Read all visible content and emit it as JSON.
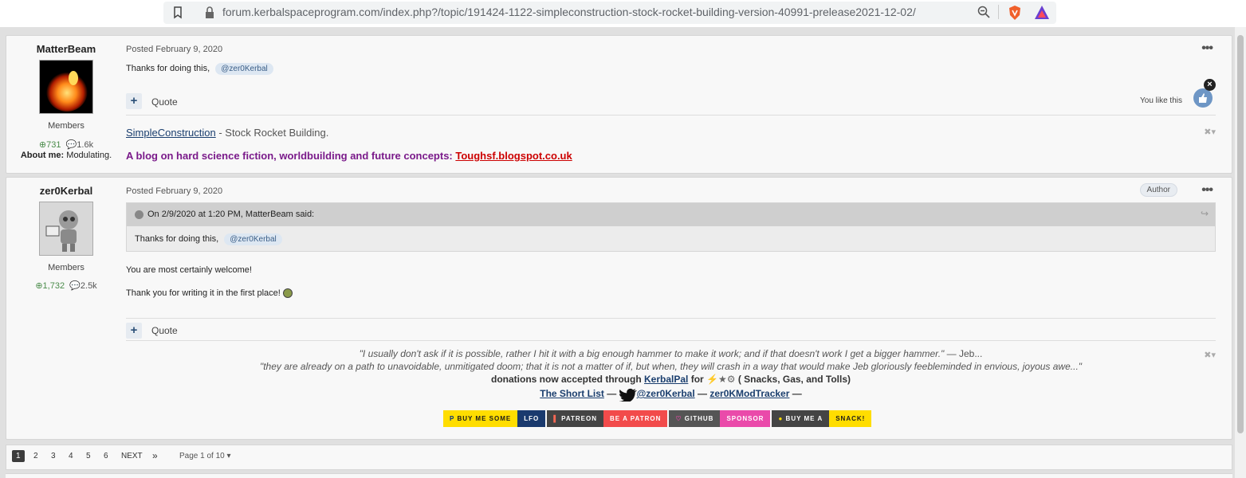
{
  "browser": {
    "url": "forum.kerbalspaceprogram.com/index.php?/topic/191424-1122-simpleconstruction-stock-rocket-building-version-40991-prelease2021-12-02/"
  },
  "posts": [
    {
      "username": "MatterBeam",
      "role": "Members",
      "reputation": "731",
      "post_count": "1.6k",
      "about_label": "About me:",
      "about_value": "Modulating.",
      "posted": "Posted February 9, 2020",
      "body": "Thanks for doing this,",
      "mention": "@zer0Kerbal",
      "quote_label": "Quote",
      "you_like": "You like this",
      "signature": {
        "link": "SimpleConstruction",
        "rest": " - Stock Rocket Building.",
        "blog_text": "A blog on hard science fiction, worldbuilding and future concepts: ",
        "blog_link": "Toughsf.blogspot.co.uk"
      }
    },
    {
      "username": "zer0Kerbal",
      "role": "Members",
      "reputation": "1,732",
      "post_count": "2.5k",
      "posted": "Posted February 9, 2020",
      "badge": "Author",
      "quote_header": "On 2/9/2020 at 1:20 PM, MatterBeam said:",
      "quote_body": "Thanks for doing this,",
      "quote_mention": "@zer0Kerbal",
      "line1": "You are most certainly welcome!",
      "line2": "Thank you for writing it in the first place!",
      "quote_label": "Quote",
      "signature": {
        "q1": "\"I usually don't ask if it is possible, rather I hit it with a big enough hammer to make it work; and if that doesn't work I get a bigger hammer.\"",
        "q1_attr": " — Jeb...",
        "q2": "\"they are already on a path to unavoidable, unmitigated doom; that it is not a matter of if, but when, they will crash in a way that would make Jeb gloriously feebleminded in envious, joyous awe...\"",
        "donation_pre": "donations now accepted through ",
        "donation_link": "KerbalPal",
        "donation_for": " for ",
        "donation_post": " ( Snacks, Gas, and Tolls)",
        "short_list": "The Short List",
        "dash": " — ",
        "twitter": "@zer0Kerbal",
        "tracker": "zer0KModTracker",
        "dash_end": " —",
        "badges": [
          {
            "left": "BUY ME SOME",
            "right": "LFO"
          },
          {
            "left": "PATREON",
            "right": "BE A PATRON"
          },
          {
            "left": "GITHUB",
            "right": "SPONSOR"
          },
          {
            "left": "BUY ME A",
            "right": "SNACK!"
          }
        ]
      }
    }
  ],
  "pagination": {
    "pages": [
      "1",
      "2",
      "3",
      "4",
      "5",
      "6"
    ],
    "next": "NEXT",
    "last": "»",
    "page_of": "Page 1 of 10"
  },
  "colors": {
    "accent_blue": "#2b4f77",
    "blog_purple": "#7a1a8a",
    "link_red": "#cc0000"
  }
}
